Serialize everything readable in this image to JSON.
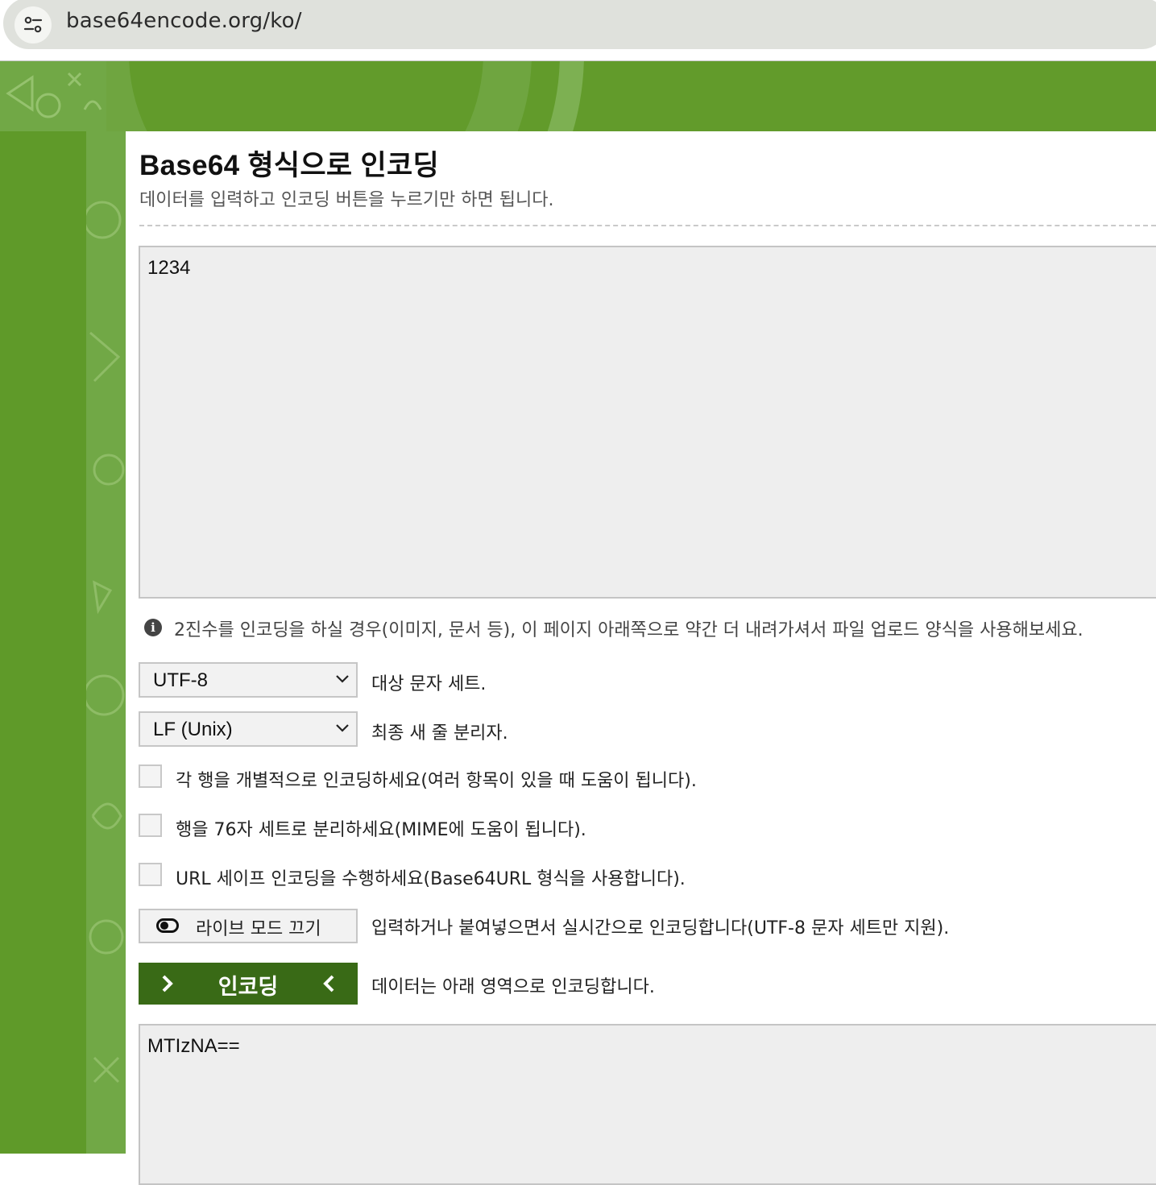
{
  "browser": {
    "url": "base64encode.org/ko/"
  },
  "page": {
    "title": "Base64 형식으로 인코딩",
    "subtitle": "데이터를 입력하고 인코딩 버튼을 누르기만 하면 됩니다.",
    "input_value": "1234",
    "hint": "2진수를 인코딩을 하실 경우(이미지, 문서 등), 이 페이지 아래쪽으로 약간 더 내려가셔서 파일 업로드 양식을 사용해보세요.",
    "charset": {
      "selected": "UTF-8",
      "label": "대상 문자 세트."
    },
    "newline": {
      "selected": "LF (Unix)",
      "label": "최종 새 줄 분리자."
    },
    "options": [
      {
        "label": "각 행을 개별적으로 인코딩하세요(여러 항목이 있을 때 도움이 됩니다).",
        "checked": false
      },
      {
        "label": "행을 76자 세트로 분리하세요(MIME에 도움이 됩니다).",
        "checked": false
      },
      {
        "label": "URL 세이프 인코딩을 수행하세요(Base64URL 형식을 사용합니다).",
        "checked": false
      }
    ],
    "live_mode": {
      "button_label": "라이브 모드 끄기",
      "description": "입력하거나 붙여넣으면서 실시간으로 인코딩합니다(UTF-8 문자 세트만 지원)."
    },
    "encode": {
      "button_label": "인코딩",
      "description": "데이터는 아래 영역으로 인코딩합니다."
    },
    "output_value": "MTIzNA=="
  },
  "colors": {
    "header_green": "#629b2b",
    "button_dark_green": "#396a16",
    "field_gray": "#eeeeee"
  }
}
